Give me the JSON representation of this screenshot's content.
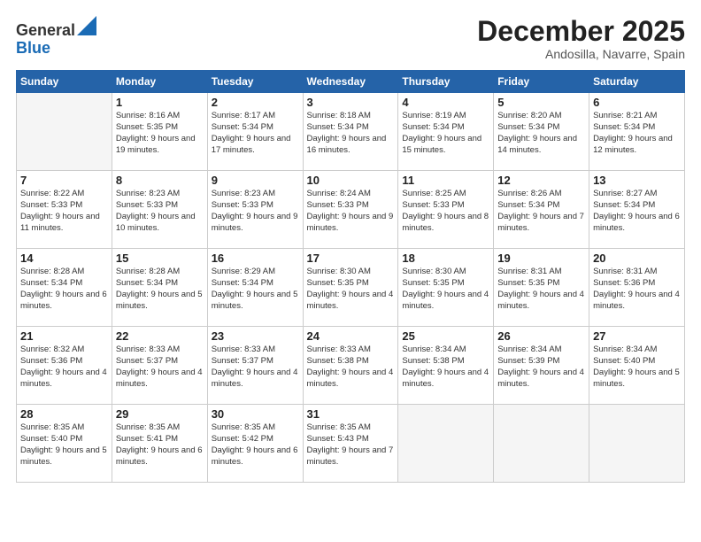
{
  "logo": {
    "general": "General",
    "blue": "Blue"
  },
  "title": "December 2025",
  "location": "Andosilla, Navarre, Spain",
  "weekdays": [
    "Sunday",
    "Monday",
    "Tuesday",
    "Wednesday",
    "Thursday",
    "Friday",
    "Saturday"
  ],
  "weeks": [
    [
      {
        "day": "",
        "sunrise": "",
        "sunset": "",
        "daylight": ""
      },
      {
        "day": "1",
        "sunrise": "Sunrise: 8:16 AM",
        "sunset": "Sunset: 5:35 PM",
        "daylight": "Daylight: 9 hours and 19 minutes."
      },
      {
        "day": "2",
        "sunrise": "Sunrise: 8:17 AM",
        "sunset": "Sunset: 5:34 PM",
        "daylight": "Daylight: 9 hours and 17 minutes."
      },
      {
        "day": "3",
        "sunrise": "Sunrise: 8:18 AM",
        "sunset": "Sunset: 5:34 PM",
        "daylight": "Daylight: 9 hours and 16 minutes."
      },
      {
        "day": "4",
        "sunrise": "Sunrise: 8:19 AM",
        "sunset": "Sunset: 5:34 PM",
        "daylight": "Daylight: 9 hours and 15 minutes."
      },
      {
        "day": "5",
        "sunrise": "Sunrise: 8:20 AM",
        "sunset": "Sunset: 5:34 PM",
        "daylight": "Daylight: 9 hours and 14 minutes."
      },
      {
        "day": "6",
        "sunrise": "Sunrise: 8:21 AM",
        "sunset": "Sunset: 5:34 PM",
        "daylight": "Daylight: 9 hours and 12 minutes."
      }
    ],
    [
      {
        "day": "7",
        "sunrise": "Sunrise: 8:22 AM",
        "sunset": "Sunset: 5:33 PM",
        "daylight": "Daylight: 9 hours and 11 minutes."
      },
      {
        "day": "8",
        "sunrise": "Sunrise: 8:23 AM",
        "sunset": "Sunset: 5:33 PM",
        "daylight": "Daylight: 9 hours and 10 minutes."
      },
      {
        "day": "9",
        "sunrise": "Sunrise: 8:23 AM",
        "sunset": "Sunset: 5:33 PM",
        "daylight": "Daylight: 9 hours and 9 minutes."
      },
      {
        "day": "10",
        "sunrise": "Sunrise: 8:24 AM",
        "sunset": "Sunset: 5:33 PM",
        "daylight": "Daylight: 9 hours and 9 minutes."
      },
      {
        "day": "11",
        "sunrise": "Sunrise: 8:25 AM",
        "sunset": "Sunset: 5:33 PM",
        "daylight": "Daylight: 9 hours and 8 minutes."
      },
      {
        "day": "12",
        "sunrise": "Sunrise: 8:26 AM",
        "sunset": "Sunset: 5:34 PM",
        "daylight": "Daylight: 9 hours and 7 minutes."
      },
      {
        "day": "13",
        "sunrise": "Sunrise: 8:27 AM",
        "sunset": "Sunset: 5:34 PM",
        "daylight": "Daylight: 9 hours and 6 minutes."
      }
    ],
    [
      {
        "day": "14",
        "sunrise": "Sunrise: 8:28 AM",
        "sunset": "Sunset: 5:34 PM",
        "daylight": "Daylight: 9 hours and 6 minutes."
      },
      {
        "day": "15",
        "sunrise": "Sunrise: 8:28 AM",
        "sunset": "Sunset: 5:34 PM",
        "daylight": "Daylight: 9 hours and 5 minutes."
      },
      {
        "day": "16",
        "sunrise": "Sunrise: 8:29 AM",
        "sunset": "Sunset: 5:34 PM",
        "daylight": "Daylight: 9 hours and 5 minutes."
      },
      {
        "day": "17",
        "sunrise": "Sunrise: 8:30 AM",
        "sunset": "Sunset: 5:35 PM",
        "daylight": "Daylight: 9 hours and 4 minutes."
      },
      {
        "day": "18",
        "sunrise": "Sunrise: 8:30 AM",
        "sunset": "Sunset: 5:35 PM",
        "daylight": "Daylight: 9 hours and 4 minutes."
      },
      {
        "day": "19",
        "sunrise": "Sunrise: 8:31 AM",
        "sunset": "Sunset: 5:35 PM",
        "daylight": "Daylight: 9 hours and 4 minutes."
      },
      {
        "day": "20",
        "sunrise": "Sunrise: 8:31 AM",
        "sunset": "Sunset: 5:36 PM",
        "daylight": "Daylight: 9 hours and 4 minutes."
      }
    ],
    [
      {
        "day": "21",
        "sunrise": "Sunrise: 8:32 AM",
        "sunset": "Sunset: 5:36 PM",
        "daylight": "Daylight: 9 hours and 4 minutes."
      },
      {
        "day": "22",
        "sunrise": "Sunrise: 8:33 AM",
        "sunset": "Sunset: 5:37 PM",
        "daylight": "Daylight: 9 hours and 4 minutes."
      },
      {
        "day": "23",
        "sunrise": "Sunrise: 8:33 AM",
        "sunset": "Sunset: 5:37 PM",
        "daylight": "Daylight: 9 hours and 4 minutes."
      },
      {
        "day": "24",
        "sunrise": "Sunrise: 8:33 AM",
        "sunset": "Sunset: 5:38 PM",
        "daylight": "Daylight: 9 hours and 4 minutes."
      },
      {
        "day": "25",
        "sunrise": "Sunrise: 8:34 AM",
        "sunset": "Sunset: 5:38 PM",
        "daylight": "Daylight: 9 hours and 4 minutes."
      },
      {
        "day": "26",
        "sunrise": "Sunrise: 8:34 AM",
        "sunset": "Sunset: 5:39 PM",
        "daylight": "Daylight: 9 hours and 4 minutes."
      },
      {
        "day": "27",
        "sunrise": "Sunrise: 8:34 AM",
        "sunset": "Sunset: 5:40 PM",
        "daylight": "Daylight: 9 hours and 5 minutes."
      }
    ],
    [
      {
        "day": "28",
        "sunrise": "Sunrise: 8:35 AM",
        "sunset": "Sunset: 5:40 PM",
        "daylight": "Daylight: 9 hours and 5 minutes."
      },
      {
        "day": "29",
        "sunrise": "Sunrise: 8:35 AM",
        "sunset": "Sunset: 5:41 PM",
        "daylight": "Daylight: 9 hours and 6 minutes."
      },
      {
        "day": "30",
        "sunrise": "Sunrise: 8:35 AM",
        "sunset": "Sunset: 5:42 PM",
        "daylight": "Daylight: 9 hours and 6 minutes."
      },
      {
        "day": "31",
        "sunrise": "Sunrise: 8:35 AM",
        "sunset": "Sunset: 5:43 PM",
        "daylight": "Daylight: 9 hours and 7 minutes."
      },
      {
        "day": "",
        "sunrise": "",
        "sunset": "",
        "daylight": ""
      },
      {
        "day": "",
        "sunrise": "",
        "sunset": "",
        "daylight": ""
      },
      {
        "day": "",
        "sunrise": "",
        "sunset": "",
        "daylight": ""
      }
    ]
  ]
}
